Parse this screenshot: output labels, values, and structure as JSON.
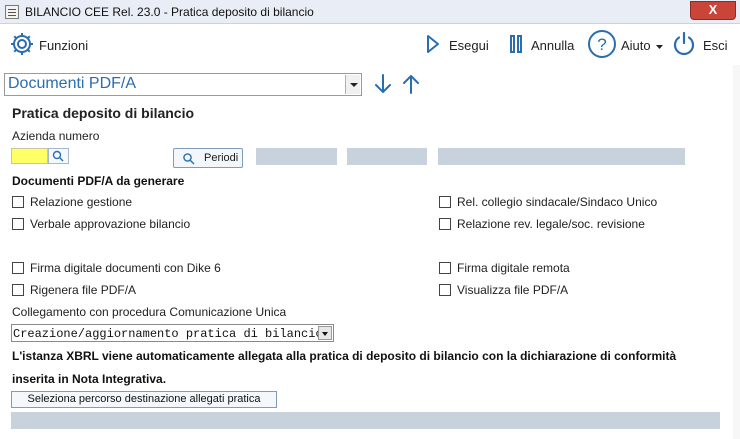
{
  "window": {
    "title": "BILANCIO CEE Rel. 23.0 - Pratica deposito di bilancio",
    "close_label": "X"
  },
  "toolbar": {
    "funzioni": "Funzioni",
    "esegui": "Esegui",
    "annulla": "Annulla",
    "aiuto": "Aiuto",
    "esci": "Esci"
  },
  "document_select": {
    "value": "Documenti PDF/A"
  },
  "form": {
    "title": "Pratica deposito di bilancio",
    "azienda_label": "Azienda numero",
    "azienda_value": "",
    "periodi_label": "Periodi",
    "docs_heading": "Documenti PDF/A da generare",
    "checkboxes": {
      "relazione_gestione": "Relazione gestione",
      "verbale_approvazione": "Verbale approvazione bilancio",
      "rel_collegio": "Rel. collegio sindacale/Sindaco Unico",
      "relazione_rev": "Relazione rev. legale/soc. revisione",
      "firma_dike": "Firma digitale documenti con Dike 6",
      "rigenera": "Rigenera file PDF/A",
      "firma_remota": "Firma digitale remota",
      "visualizza": "Visualizza file PDF/A"
    },
    "collegamento_label": "Collegamento con procedura Comunicazione Unica",
    "collegamento_value": "Creazione/aggiornamento pratica di bilancio",
    "info_line1": "L'istanza XBRL viene automaticamente allegata alla pratica di deposito di bilancio con la dichiarazione di conformità",
    "info_line2": "inserita in Nota Integrativa.",
    "path_button": "Seleziona percorso destinazione allegati pratica",
    "path_value": ""
  },
  "colors": {
    "accent": "#2a6db0",
    "required_field": "#ffff66",
    "readonly_field": "#c8d2dc"
  }
}
